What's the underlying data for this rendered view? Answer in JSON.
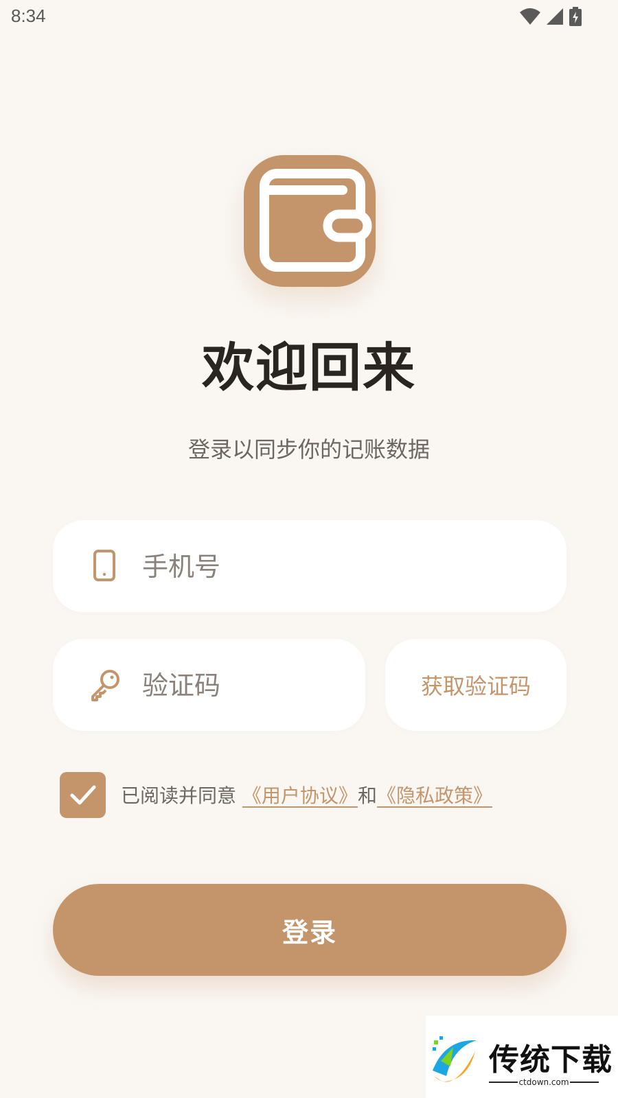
{
  "status_bar": {
    "time": "8:34",
    "icons": [
      "wifi-icon",
      "signal-icon",
      "battery-charging-icon"
    ]
  },
  "app": {
    "logo_icon": "wallet-icon",
    "title": "欢迎回来",
    "subtitle": "登录以同步你的记账数据"
  },
  "form": {
    "phone": {
      "icon": "phone-icon",
      "placeholder": "手机号",
      "value": ""
    },
    "code": {
      "icon": "key-icon",
      "placeholder": "验证码",
      "value": ""
    },
    "get_code_label": "获取验证码",
    "agreement": {
      "checked": true,
      "prefix": "已阅读并同意",
      "user_agreement": "《用户协议》",
      "conjunction": "和",
      "privacy_policy": "《隐私政策》"
    },
    "login_label": "登录"
  },
  "watermark": {
    "name": "传统下载",
    "domain": "ctdown.com"
  },
  "colors": {
    "accent": "#c4956b",
    "background": "#faf7f3",
    "title": "#2a2520",
    "muted_text": "#6e6760"
  }
}
